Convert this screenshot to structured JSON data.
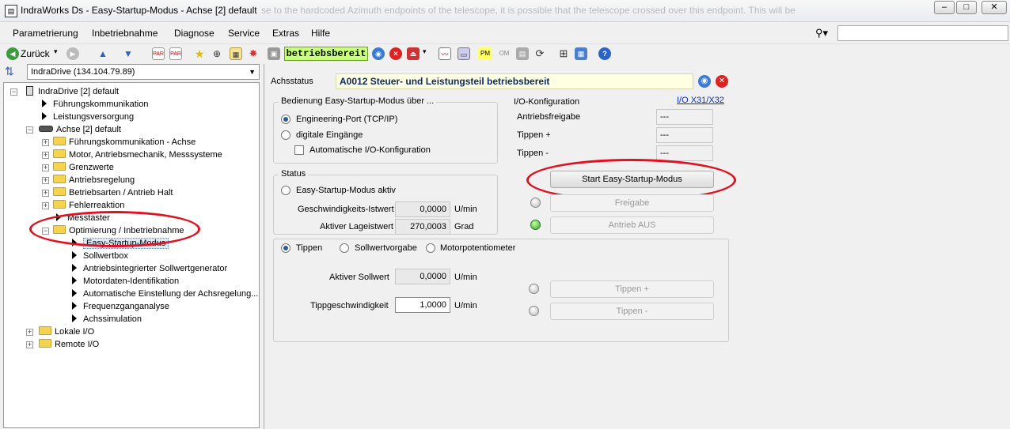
{
  "window": {
    "title": "IndraWorks Ds - Easy-Startup-Modus - Achse [2] default",
    "background_text": "se to the hardcoded Azimuth endpoints of the telescope, it is possible that the telescope crossed over this endpoint. This will be",
    "minimize": "–",
    "maximize": "□",
    "close": "✕"
  },
  "menu": [
    "Parametrierung",
    "Inbetriebnahme",
    "Diagnose",
    "Service",
    "Extras",
    "Hilfe"
  ],
  "toolbar": {
    "back_label": "Zurück",
    "status_label": "betriebsbereit",
    "pm": "PM",
    "om": "OM"
  },
  "device": {
    "selected": "IndraDrive (134.104.79.89)"
  },
  "tree": {
    "root": "IndraDrive [2] default",
    "fuehrungskomm": "Führungskommunikation",
    "leistung": "Leistungsversorgung",
    "achse": "Achse [2] default",
    "achse_children": [
      "Führungskommunikation - Achse",
      "Motor, Antriebsmechanik, Messsysteme",
      "Grenzwerte",
      "Antriebsregelung",
      "Betriebsarten / Antrieb Halt",
      "Fehlerreaktion"
    ],
    "messtaster": "Messtaster",
    "optimierung": "Optimierung / Inbetriebnahme",
    "optimierung_children": [
      "Easy-Startup-Modus",
      "Sollwertbox",
      "Antriebsintegrierter Sollwertgenerator",
      "Motordaten-Identifikation",
      "Automatische Einstellung der Achsregelung...",
      "Frequenzganganalyse",
      "Achssimulation"
    ],
    "lokale": "Lokale I/O",
    "remote": "Remote I/O"
  },
  "achsstatus": {
    "label": "Achsstatus",
    "value": "A0012 Steuer- und Leistungsteil betriebsbereit"
  },
  "bedienung": {
    "legend": "Bedienung Easy-Startup-Modus über ...",
    "option_port": "Engineering-Port (TCP/IP)",
    "option_digital": "digitale Eingänge",
    "auto_io": "Automatische I/O-Konfiguration"
  },
  "io": {
    "legend": "I/O-Konfiguration",
    "link": "I/O X31/X32",
    "rows": [
      {
        "label": "Antriebsfreigabe",
        "value": "---"
      },
      {
        "label": "Tippen +",
        "value": "---"
      },
      {
        "label": "Tippen -",
        "value": "---"
      }
    ]
  },
  "status": {
    "legend": "Status",
    "aktiv": "Easy-Startup-Modus aktiv",
    "speed_label": "Geschwindigkeits-Istwert",
    "speed_value": "0,0000",
    "speed_unit": "U/min",
    "pos_label": "Aktiver Lageistwert",
    "pos_value": "270,0003",
    "pos_unit": "Grad"
  },
  "buttons": {
    "start": "Start Easy-Startup-Modus",
    "freigabe": "Freigabe",
    "antrieb_aus": "Antrieb AUS",
    "tippen_plus": "Tippen +",
    "tippen_minus": "Tippen -"
  },
  "mode": {
    "tippen": "Tippen",
    "sollwert": "Sollwertvorgabe",
    "motorpot": "Motorpotentiometer",
    "aktiv_label": "Aktiver Sollwert",
    "aktiv_value": "0,0000",
    "aktiv_unit": "U/min",
    "tipp_label": "Tippgeschwindigkeit",
    "tipp_value": "1,0000",
    "tipp_unit": "U/min"
  },
  "colors": {
    "annotation_red": "#e0121f",
    "status_green": "#c8ff7a",
    "achsstatus_bg": "#ffffe1"
  }
}
